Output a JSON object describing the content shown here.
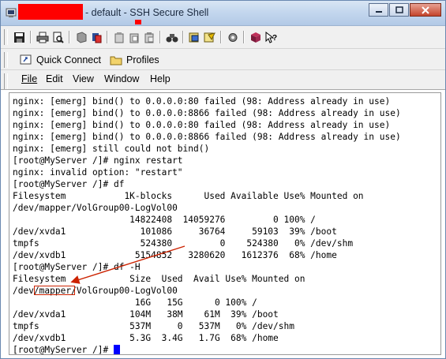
{
  "window": {
    "title": "- default - SSH Secure Shell"
  },
  "quick_bar": {
    "quick_connect": "Quick Connect",
    "profiles": "Profiles"
  },
  "menu": {
    "file": "File",
    "edit": "Edit",
    "view": "View",
    "window": "Window",
    "help": "Help"
  },
  "toolbar_icons": [
    "save-icon",
    "print-icon",
    "print-preview-icon",
    "copy-icon",
    "paste-icon",
    "sftp-icon",
    "cut-icon",
    "copy-clipboard-icon",
    "paste-clipboard-icon",
    "find-icon",
    "settings-icon",
    "profile-icon",
    "options-icon",
    "help-book-icon",
    "context-help-icon"
  ],
  "terminal": {
    "lines": [
      "nginx: [emerg] bind() to 0.0.0.0:80 failed (98: Address already in use)",
      "nginx: [emerg] bind() to 0.0.0.0:8866 failed (98: Address already in use)",
      "nginx: [emerg] bind() to 0.0.0.0:80 failed (98: Address already in use)",
      "nginx: [emerg] bind() to 0.0.0.0:8866 failed (98: Address already in use)",
      "nginx: [emerg] still could not bind()",
      "[root@MyServer /]# nginx restart",
      "nginx: invalid option: \"restart\"",
      "[root@MyServer /]# df",
      "Filesystem           1K-blocks      Used Available Use% Mounted on",
      "/dev/mapper/VolGroup00-LogVol00",
      "                      14822408  14059276         0 100% /",
      "/dev/xvda1              101086     36764     59103  39% /boot",
      "tmpfs                   524380         0    524380   0% /dev/shm",
      "/dev/xvdb1             5154852   3280620   1612376  68% /home",
      "[root@MyServer /]# df -H",
      "Filesystem            Size  Used  Avail Use% Mounted on",
      "/dev/mapper/VolGroup00-LogVol00",
      "                       16G   15G      0 100% /",
      "/dev/xvda1            104M   38M    61M  39% /boot",
      "tmpfs                 537M     0   537M   0% /dev/shm",
      "/dev/xvdb1            5.3G  3.4G   1.7G  68% /home",
      "[root@MyServer /]# "
    ]
  },
  "colors": {
    "annotation": "#cc2200",
    "cursor": "#0000ff",
    "redaction": "#ff0000"
  }
}
